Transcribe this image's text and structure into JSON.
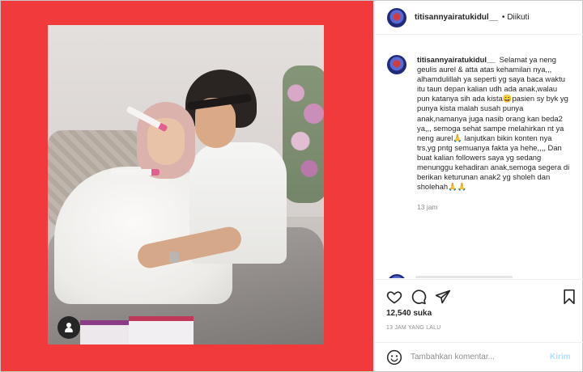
{
  "header": {
    "username": "titisannyairatukidul__",
    "separator": "•",
    "follow_label": "Diikuti"
  },
  "caption": {
    "username": "titisannyairatukidul__",
    "text": "Selamat ya neng geulis aurel & atta atas kehamilan nya,,, alhamdulillah ya seperti yg saya baca waktu itu taun depan kalian udh ada anak,walau pun katanya sih ada kista😄pasien sy byk yg punya kista malah susah punya anak,namanya juga nasib orang kan beda2 ya,,, semoga sehat sampe melahirkan nt ya neng aurel🙏 lanjutkan bikin konten nya trs,yg pntg semuanya fakta ya hehe,,,, Dan buat kalian followers saya yg sedang menunggu kehadiran anak,semoga segera di berikan keturunan anak2 yg sholeh dan sholehah🙏🙏",
    "time": "13 jam"
  },
  "actions": {
    "icons": [
      "heart-icon",
      "comment-icon",
      "share-icon",
      "bookmark-icon"
    ],
    "likes": "12,540 suka",
    "posted": "13 JAM YANG LALU"
  },
  "comment_box": {
    "placeholder": "Tambahkan komentar...",
    "send_label": "Kirim"
  },
  "colors": {
    "media_background": "#f03a3c",
    "send_disabled": "#b2dffc",
    "muted_text": "#8e8e8e"
  }
}
